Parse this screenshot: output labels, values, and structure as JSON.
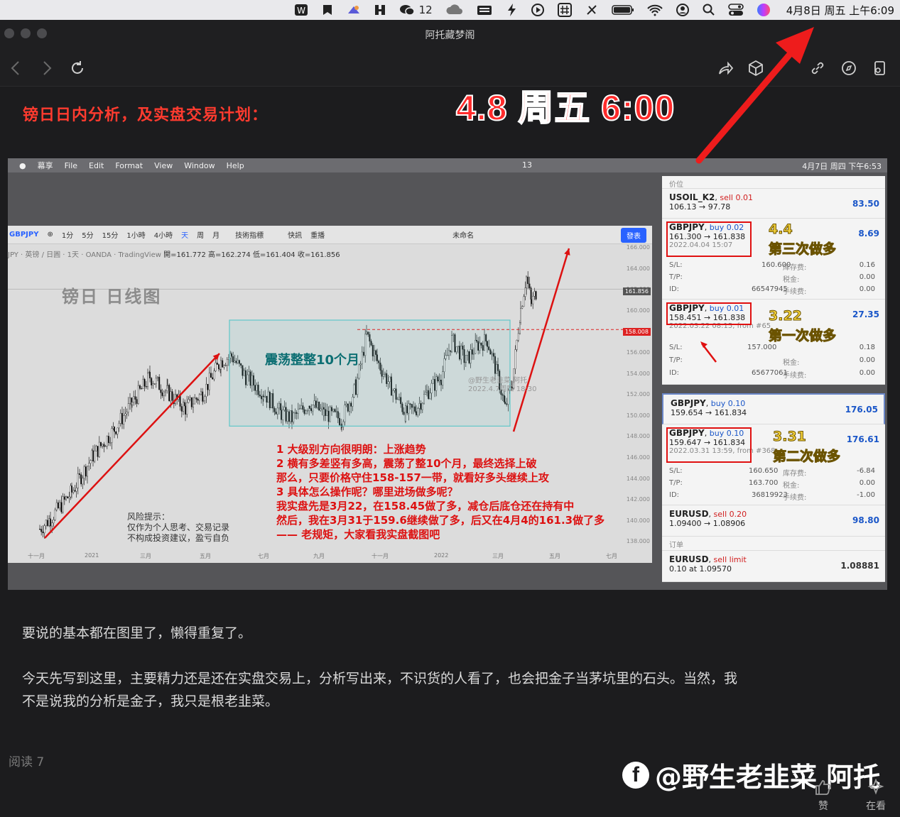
{
  "menubar": {
    "wechat_count": "12",
    "clock": "4月8日 周五 上午6:09",
    "icons": [
      "wps-icon",
      "bookmark-icon",
      "paint-icon",
      "bear-icon",
      "wechat-icon",
      "cloud-icon",
      "keyboard-icon",
      "dollar-icon",
      "play-icon",
      "grid-icon",
      "mute-icon",
      "battery-icon",
      "wifi-icon",
      "user-icon",
      "search-icon",
      "control-center-icon",
      "siri-icon"
    ]
  },
  "window": {
    "title": "阿托藏梦阁"
  },
  "toolbar": {
    "icons": [
      "back-icon",
      "forward-icon",
      "reload-icon",
      "share-icon",
      "box-icon",
      "link-icon",
      "compass-icon",
      "profile-icon"
    ]
  },
  "article": {
    "heading": "镑日日内分析，及实盘交易计划：",
    "annotation_time": "4.8 周五 6:00",
    "paragraph1": "要说的基本都在图里了，懒得重复了。",
    "paragraph2_line1": "今天先写到这里，主要精力还是还在实盘交易上，分析写出来，不识货的人看了，也会把金子当茅坑里的石头。当然，我",
    "paragraph2_line2": "不是说我的分析是金子，我只是根老韭菜。",
    "read_count": "阅读 7",
    "brand": "@野生老韭菜 阿托",
    "like_label": "赞",
    "watching_label": "在看"
  },
  "screenshot": {
    "inner_menubar": {
      "items": [
        "幕享",
        "File",
        "Edit",
        "Format",
        "View",
        "Window",
        "Help"
      ],
      "wechat_count": "13",
      "clock": "4月7日 周四 下午6:53"
    },
    "tradingview": {
      "symbol": "GBPJPY",
      "intervals": [
        "1分",
        "5分",
        "15分",
        "1小時",
        "4小時",
        "天",
        "周",
        "月"
      ],
      "indicators_label": "技術指標",
      "quick_label": "快訊",
      "replay_label": "重播",
      "unnamed_label": "未命名",
      "publish_label": "發表",
      "ohlc_prefix": "JPY · 英镑 / 日圓 · 1天 · OANDA · TradingView",
      "open": "開=161.772",
      "high": "高=162.274",
      "low": "低=161.404",
      "close": "收=161.856",
      "chart_title": "镑日  日线图",
      "zone_label": "震荡整整10个月",
      "watermark_line1": "@野生老韭菜 阿托",
      "watermark_line2": "2022.4.7周四 18:30",
      "risk_line1": "风险提示：",
      "risk_line2": "仅作为个人思考、交易记录",
      "risk_line3": "不构成投资建议，盈亏自负",
      "notes": [
        "1 大级别方向很明朗：上涨趋势",
        "2 横有多差竖有多高，震荡了整10个月，最终选择上破",
        "   那么，只要价格守住158-157一带，就看好多头继续上攻",
        "3 具体怎么操作呢？哪里进场做多呢？",
        "   我实盘先是3月22，在158.45做了多，减仓后底仓还在持有中",
        "   然后，我在3月31于159.6继续做了多，后又在4月4的161.3做了多",
        "—— 老规矩，大家看我实盘截图吧"
      ],
      "price_current": "161.856",
      "price_line": "158.008",
      "y_ticks": [
        "166.000",
        "164.000",
        "162.000",
        "160.000",
        "158.000",
        "156.000",
        "154.000",
        "152.000",
        "150.000",
        "148.000",
        "146.000",
        "144.000",
        "142.000",
        "140.000",
        "138.000"
      ],
      "x_ticks": [
        "十一月",
        "2021",
        "三月",
        "五月",
        "七月",
        "九月",
        "十一月",
        "2022",
        "三月",
        "五月",
        "七月"
      ]
    },
    "panel": {
      "header": "价位",
      "orders_header": "订单",
      "positions": [
        {
          "symbol": "USOIL_K2",
          "side": "sell 0.01",
          "prices": "106.13 → 97.78",
          "value": "83.50"
        },
        {
          "symbol": "GBPJPY",
          "side": "buy 0.02",
          "prices": "161.300 → 161.838",
          "value": "8.69",
          "time": "2022.04.04 15:07",
          "sl": "160.600",
          "tp": "",
          "id": "66547945",
          "swap": "0.16",
          "tax": "0.00",
          "fee": "0.00",
          "note": "4.4",
          "note2": "第三次做多"
        },
        {
          "symbol": "GBPJPY",
          "side": "buy 0.01",
          "prices": "158.451 → 161.838",
          "value": "27.35",
          "time": "2022.03.22 08:15, from #65",
          "sl": "157.000",
          "tp": "",
          "id": "65677061",
          "swap": "0.18",
          "tax": "0.00",
          "fee": "0.00",
          "note": "3.22",
          "note2": "第一次做多"
        },
        {
          "symbol": "GBPJPY",
          "side": "buy 0.10",
          "prices": "159.654 → 161.834",
          "value": "176.05"
        },
        {
          "symbol": "GBPJPY",
          "side": "buy 0.10",
          "prices": "159.647 → 161.834",
          "value": "176.61",
          "time": "2022.03.31 13:59, from #368",
          "sl": "160.650",
          "tp": "163.700",
          "id": "36819923",
          "swap": "-6.84",
          "tax": "0.00",
          "fee": "-1.00",
          "note": "3.31",
          "note2": "第二次做多"
        },
        {
          "symbol": "EURUSD",
          "side": "sell 0.20",
          "prices": "1.09400 → 1.08906",
          "value": "98.80"
        }
      ],
      "order": {
        "symbol": "EURUSD",
        "side": "sell limit",
        "detail": "0.10 at 1.09570",
        "value": "1.08881"
      },
      "labels": {
        "sl": "S/L:",
        "tp": "T/P:",
        "id": "ID:",
        "swap": "库存费:",
        "tax": "税金:",
        "fee": "手续费:"
      }
    }
  },
  "colors": {
    "accent_red": "#ff3b2f",
    "buy_blue": "#1a56c8",
    "sell_red": "#d12020",
    "zone_teal": "#5fc7c9"
  }
}
